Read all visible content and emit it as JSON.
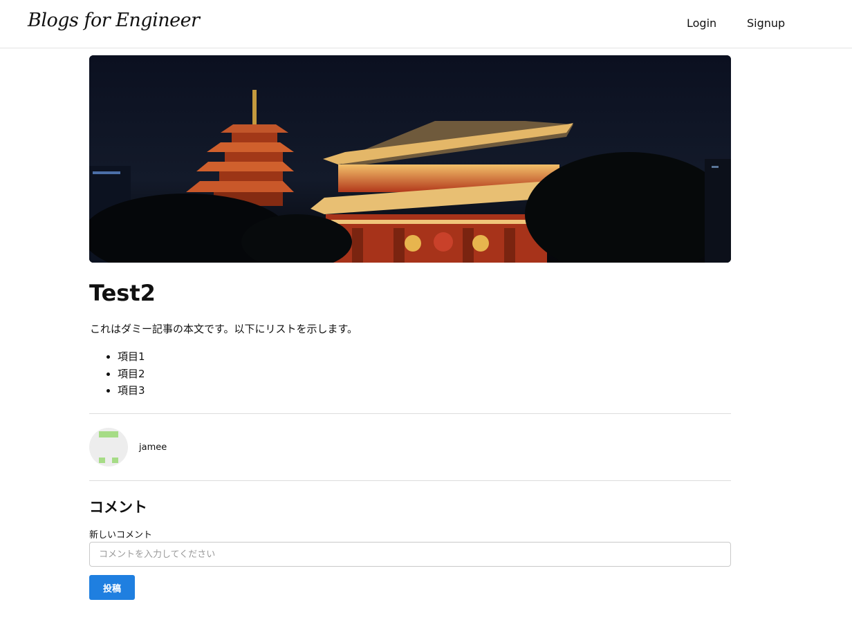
{
  "header": {
    "logo_text": "Blogs for Engineer",
    "nav": {
      "login_label": "Login",
      "signup_label": "Signup"
    }
  },
  "article": {
    "hero_image_icon": "temple-gate-night-photo",
    "title": "Test2",
    "intro": "これはダミー記事の本文です。以下にリストを示します。",
    "list_items": [
      "項目1",
      "項目2",
      "項目3"
    ]
  },
  "author": {
    "avatar_icon": "identicon-avatar",
    "avatar_color": "#a6dc86",
    "name": "jamee"
  },
  "comments": {
    "heading": "コメント",
    "new_comment_label": "新しいコメント",
    "input_value": "",
    "input_placeholder": "コメントを入力してください",
    "submit_label": "投稿",
    "submit_color": "#1f7fe0"
  }
}
